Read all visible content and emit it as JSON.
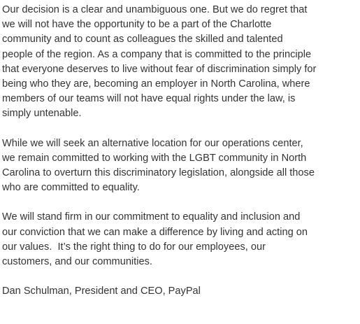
{
  "document": {
    "paragraphs": [
      {
        "lines": [
          "Our decision is a clear and unambiguous one. But we do regret that",
          "we will not have the opportunity to be a part of the Charlotte",
          "community and to count as colleagues the skilled and talented",
          "people of the region. As a company that is committed to the principle",
          "that everyone deserves to live without fear of discrimination simply for",
          "being who they are, becoming an employer in North Carolina, where",
          "members of our teams will not have equal rights under the law, is",
          "simply untenable."
        ]
      },
      {
        "lines": [
          "While we will seek an alternative location for our operations center,",
          "we remain committed to working with the LGBT community in North",
          "Carolina to overturn this discriminatory legislation, alongside all those",
          "who are committed to equality."
        ]
      },
      {
        "lines": [
          "We will stand firm in our commitment to equality and inclusion and",
          "our conviction that we can make a difference by living and acting on",
          "our values.  It’s the right thing to do for our employees, our",
          "customers, and our communities."
        ]
      }
    ],
    "signature": "Dan Schulman, President and CEO, PayPal"
  }
}
